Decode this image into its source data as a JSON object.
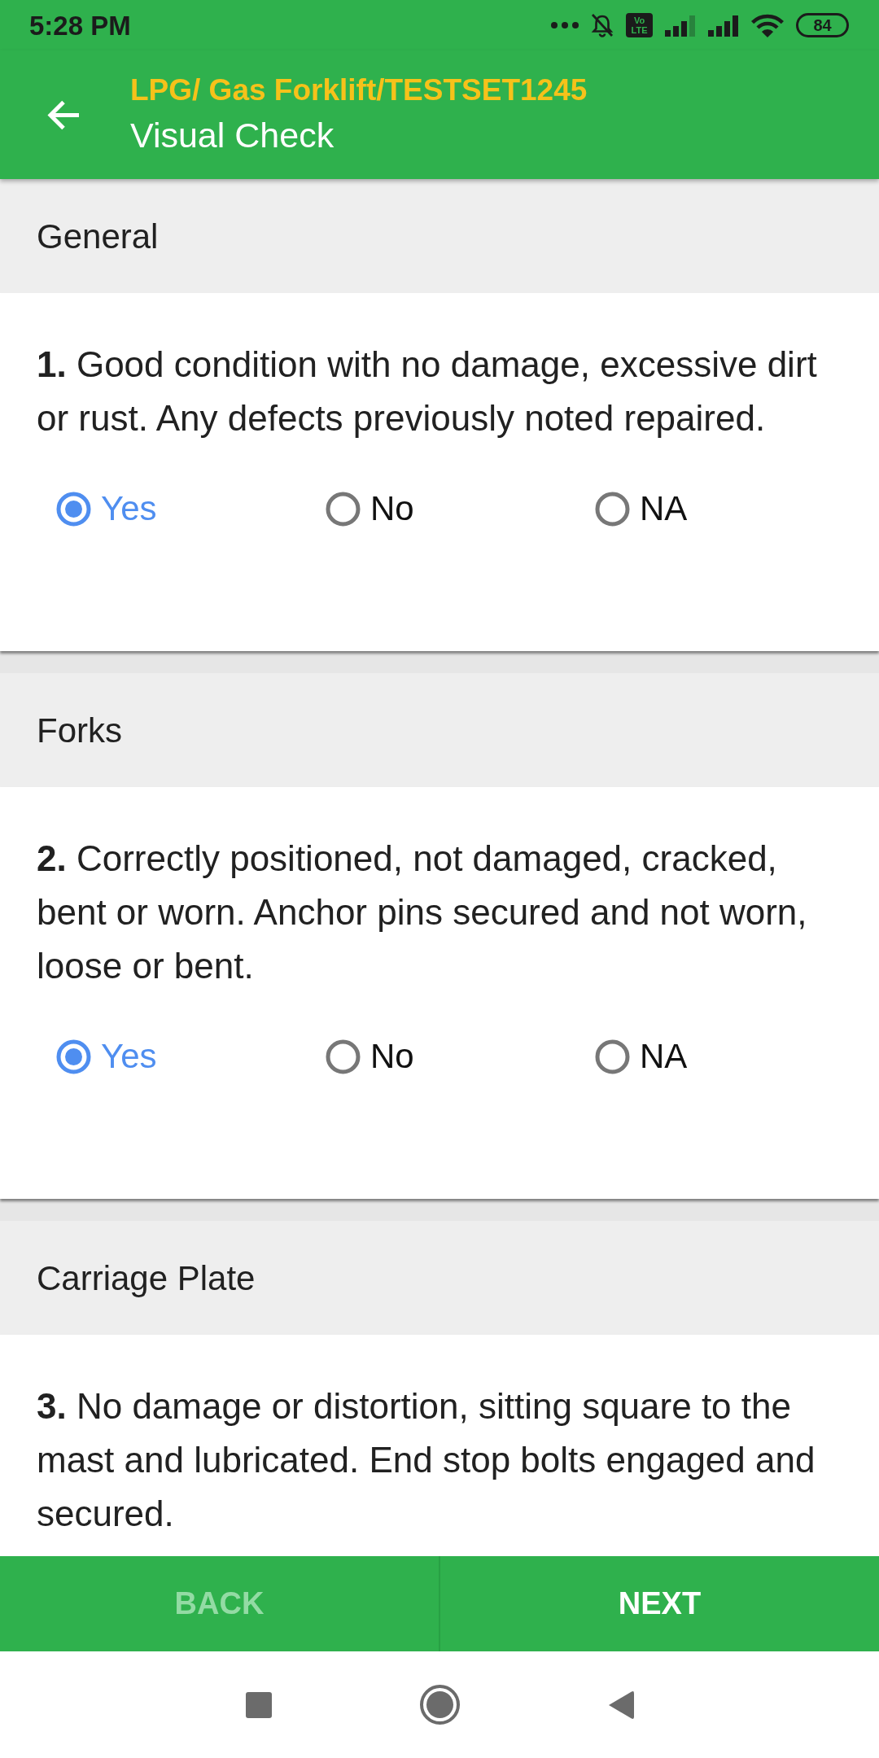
{
  "status_bar": {
    "time": "5:28 PM",
    "network_badge": "Vo LTE",
    "battery": "84"
  },
  "app_bar": {
    "title": "LPG/ Gas Forklift/TESTSET1245",
    "subtitle": "Visual Check"
  },
  "sections": [
    {
      "heading": "General",
      "questions": [
        {
          "text": "**1.** Good condition with no damage, excessive dirt or rust. Any defects previously noted repaired.",
          "options": [
            {
              "label": "Yes",
              "selected": true
            },
            {
              "label": "No",
              "selected": false
            },
            {
              "label": "NA",
              "selected": false
            }
          ]
        }
      ]
    },
    {
      "heading": "Forks",
      "questions": [
        {
          "text": "**2.** Correctly positioned, not damaged, cracked, bent or worn. Anchor pins secured and not worn, loose or bent.",
          "options": [
            {
              "label": "Yes",
              "selected": true
            },
            {
              "label": "No",
              "selected": false
            },
            {
              "label": "NA",
              "selected": false
            }
          ]
        }
      ]
    },
    {
      "heading": "Carriage Plate",
      "questions": [
        {
          "text": "**3.** No damage or distortion, sitting square to the mast and lubricated. End stop bolts engaged and secured."
        }
      ]
    }
  ],
  "footer": {
    "buttons": [
      {
        "label": "BACK",
        "disabled": true
      },
      {
        "label": "NEXT",
        "disabled": false
      }
    ]
  }
}
